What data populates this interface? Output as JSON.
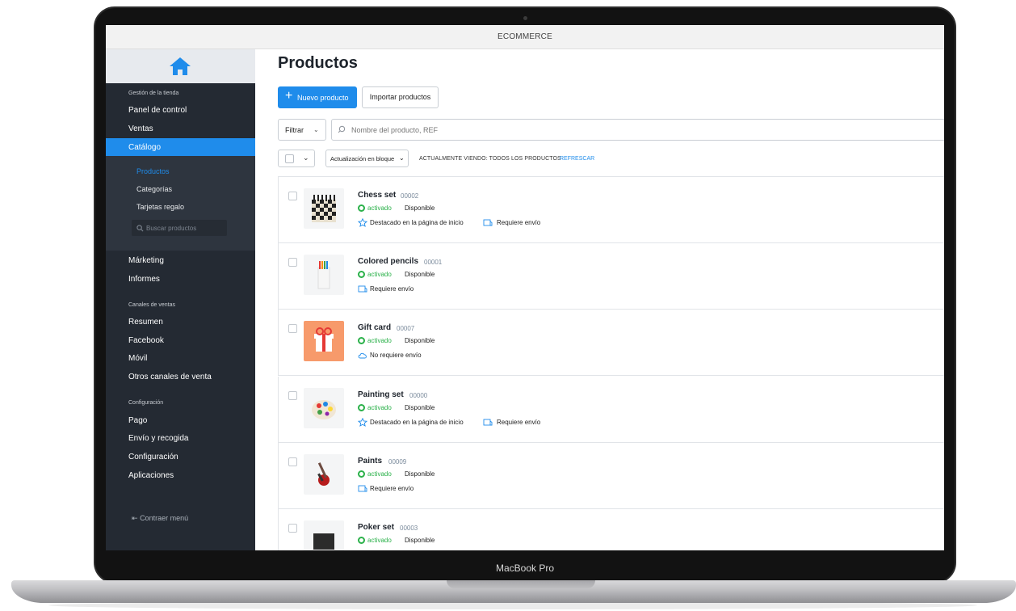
{
  "window": {
    "title": "ECOMMERCE",
    "device_label": "MacBook Pro"
  },
  "sidebar": {
    "sections": [
      {
        "heading": "Gestión de la tienda",
        "items": [
          "Panel de control",
          "Ventas",
          "Catálogo"
        ]
      },
      {
        "sub_items": [
          "Productos",
          "Categorías",
          "Tarjetas regalo"
        ],
        "search_placeholder": "Buscar productos"
      },
      {
        "items": [
          "Márketing",
          "Informes"
        ]
      },
      {
        "heading": "Canales de ventas",
        "items": [
          "Resumen",
          "Facebook",
          "Móvil",
          "Otros canales de venta"
        ]
      },
      {
        "heading": "Configuración",
        "items": [
          "Pago",
          "Envío y recogida",
          "Configuración",
          "Aplicaciones"
        ]
      }
    ],
    "active_item": "Catálogo",
    "active_sub_item": "Productos",
    "collapse_label": "Contraer menú"
  },
  "main": {
    "title": "Productos",
    "new_button": "Nuevo producto",
    "import_button": "Importar productos",
    "filter_label": "Filtrar",
    "search_placeholder": "Nombre del producto, REF",
    "bulk_update_label": "Actualización en bloque",
    "viewing_text": "ACTUALMENTE VIENDO: TODOS LOS PRODUCTOS",
    "refresh_link": "REFRESCAR"
  },
  "products": [
    {
      "name": "Chess set",
      "sku": "00002",
      "status": "activado",
      "availability": "Disponible",
      "tags": [
        "Destacado en la página de inicio",
        "Requiere envío"
      ],
      "thumb_icon": "chessboard-icon"
    },
    {
      "name": "Colored pencils",
      "sku": "00001",
      "status": "activado",
      "availability": "Disponible",
      "tags": [
        "Requiere envío"
      ],
      "thumb_icon": "pencils-icon"
    },
    {
      "name": "Gift card",
      "sku": "00007",
      "status": "activado",
      "availability": "Disponible",
      "tags": [
        "No requiere envío"
      ],
      "thumb_icon": "gift-icon"
    },
    {
      "name": "Painting set",
      "sku": "00000",
      "status": "activado",
      "availability": "Disponible",
      "tags": [
        "Destacado en la página de inicio",
        "Requiere envío"
      ],
      "thumb_icon": "palette-icon"
    },
    {
      "name": "Paints",
      "sku": "00009",
      "status": "activado",
      "availability": "Disponible",
      "tags": [
        "Requiere envío"
      ],
      "thumb_icon": "paint-jar-icon"
    },
    {
      "name": "Poker set",
      "sku": "00003",
      "status": "activado",
      "availability": "Disponible",
      "tags": [],
      "thumb_icon": "poker-case-icon"
    }
  ],
  "colors": {
    "accent": "#1f8ceb",
    "sidebar": "#242a33",
    "status_green": "#2bb14a"
  }
}
